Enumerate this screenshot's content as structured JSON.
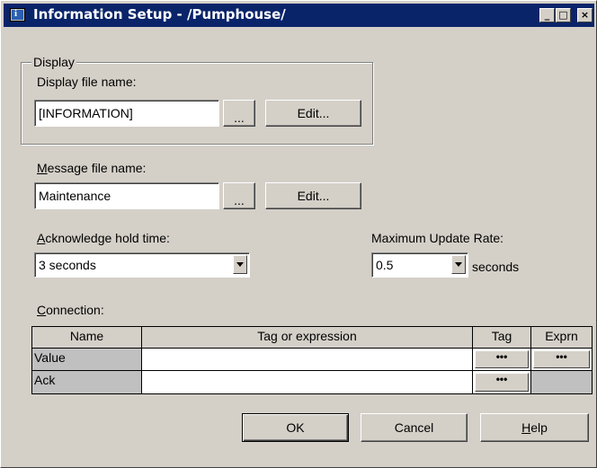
{
  "window": {
    "title": "Information Setup - /Pumphouse/",
    "controls": {
      "minimize": "_",
      "maximize": "□",
      "close": "×"
    }
  },
  "display_group": {
    "caption": "Display",
    "file_label": "Display file name:",
    "file_value": "[INFORMATION]",
    "browse_label": "...",
    "edit_label": "Edit..."
  },
  "message": {
    "label_accel": "M",
    "label_rest": "essage file name:",
    "file_value": "Maintenance",
    "browse_label": "...",
    "edit_label": "Edit..."
  },
  "acknowledge": {
    "label_accel": "A",
    "label_rest": "cknowledge hold time:",
    "value": "3 seconds"
  },
  "update_rate": {
    "label": "Maximum Update Rate:",
    "value": "0.5",
    "unit": "seconds"
  },
  "connection": {
    "label_accel": "C",
    "label_rest": "onnection:",
    "columns": [
      "Name",
      "Tag or expression",
      "Tag",
      "Exprn"
    ],
    "rows": [
      {
        "name": "Value",
        "expression": "",
        "tag_btn": "•••",
        "exprn_btn": "•••"
      },
      {
        "name": "Ack",
        "expression": "",
        "tag_btn": "•••",
        "exprn_btn": ""
      }
    ]
  },
  "buttons": {
    "ok": "OK",
    "cancel": "Cancel",
    "help_accel": "H",
    "help_rest": "elp"
  },
  "colors": {
    "title_bar": "#0a246a",
    "face": "#d4d0c8"
  }
}
